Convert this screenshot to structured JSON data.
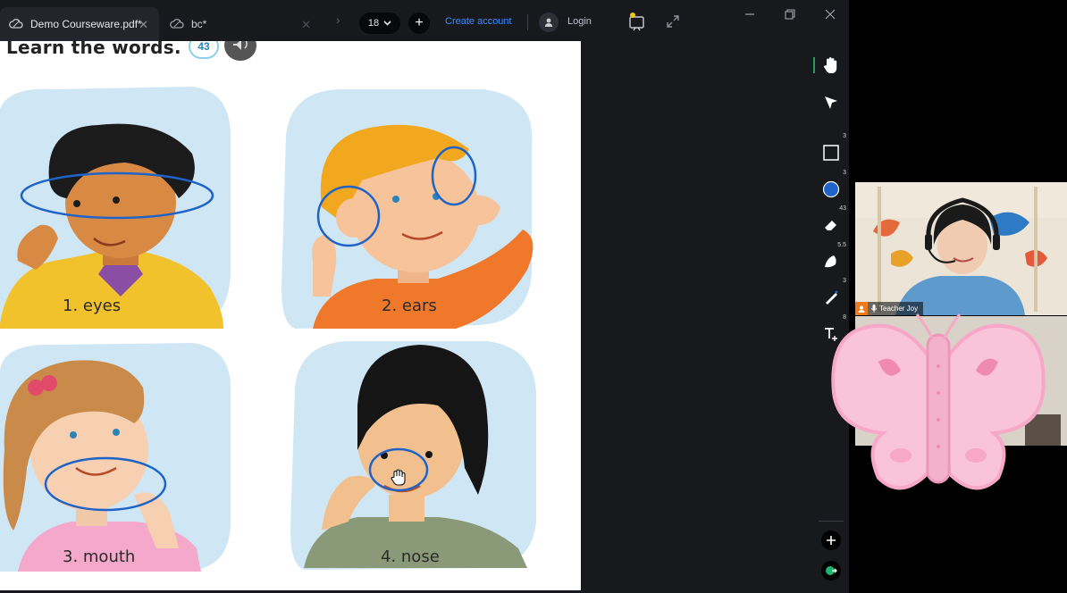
{
  "tabs": [
    {
      "label": "Demo Courseware.pdf*",
      "close": "✕"
    },
    {
      "label": "bc*",
      "close": "✕"
    }
  ],
  "toolbar": {
    "page_value": "18",
    "create_account": "Create account",
    "login": "Login"
  },
  "document": {
    "heading": "Learn the words.",
    "track_number": "43",
    "items": [
      {
        "caption": "1. eyes"
      },
      {
        "caption": "2. ears"
      },
      {
        "caption": "3. mouth"
      },
      {
        "caption": "4. nose"
      }
    ]
  },
  "sidebar": {
    "badges": {
      "rectangle": "3",
      "circle": "3",
      "eraser": "43",
      "fill": "5.5",
      "pen": "3",
      "text": "8"
    }
  },
  "video": {
    "participant_name": "Teacher Joy"
  },
  "colors": {
    "accent_link": "#3d8bff",
    "annotation_blue": "#1f63c8",
    "background_panel": "#17191d",
    "teacher_badge": "#f07b1a"
  },
  "icons": [
    "cloud-icon",
    "close-icon",
    "chevron-right-icon",
    "chevron-down-icon",
    "plus-icon",
    "user-icon",
    "board-icon",
    "expand-icon",
    "minimize-icon",
    "restore-icon",
    "hand-icon",
    "pointer-icon",
    "rectangle-icon",
    "circle-icon",
    "eraser-icon",
    "fill-icon",
    "pen-icon",
    "text-icon",
    "add-icon",
    "exit-icon",
    "speaker-icon",
    "mic-icon",
    "grab-cursor-icon"
  ]
}
